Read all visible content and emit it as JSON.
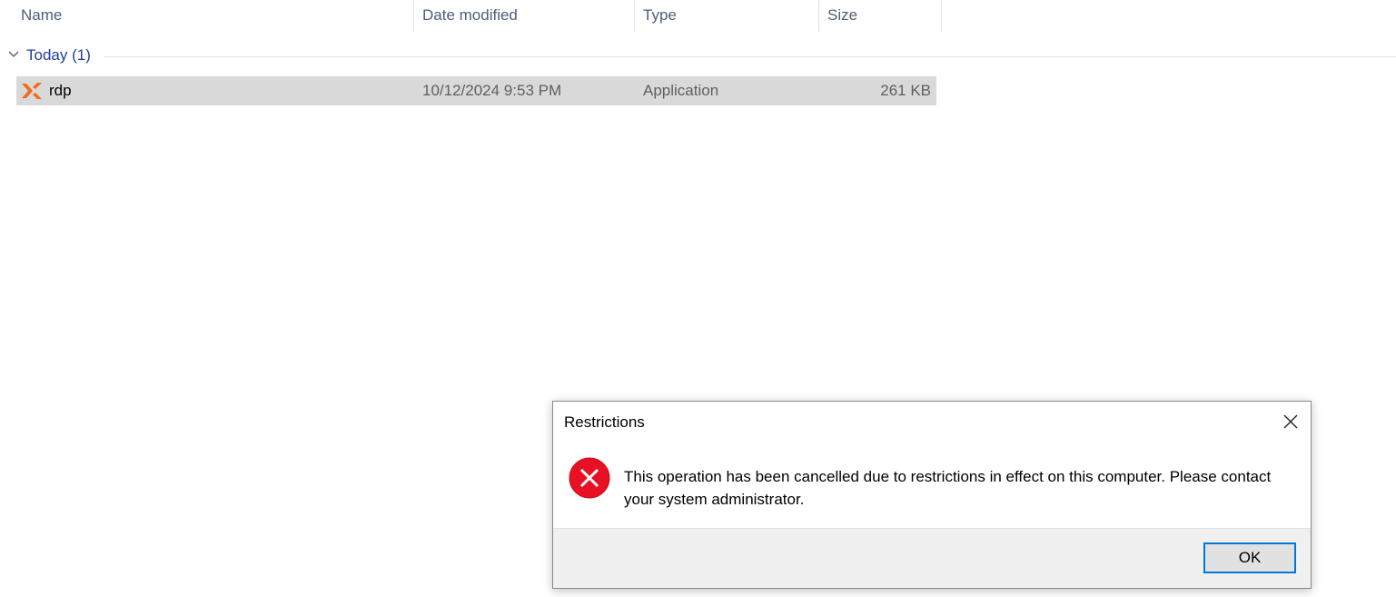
{
  "columns": {
    "name": "Name",
    "date_modified": "Date modified",
    "type": "Type",
    "size": "Size"
  },
  "group": {
    "label": "Today (1)",
    "icon": "chevron-down-icon"
  },
  "files": [
    {
      "name": "rdp",
      "date_modified": "10/12/2024 9:53 PM",
      "type": "Application",
      "size": "261 KB",
      "icon": "anydesk-app-icon",
      "selected": true
    }
  ],
  "dialog": {
    "title": "Restrictions",
    "message": "This operation has been cancelled due to restrictions in effect on this computer. Please contact your system administrator.",
    "ok_label": "OK",
    "icon": "error-icon"
  },
  "colors": {
    "selection": "#d9d9d9",
    "group_label": "#1f3f9a",
    "error_red": "#e81123",
    "button_border": "#0078d7",
    "app_icon": "#f26b1d"
  }
}
